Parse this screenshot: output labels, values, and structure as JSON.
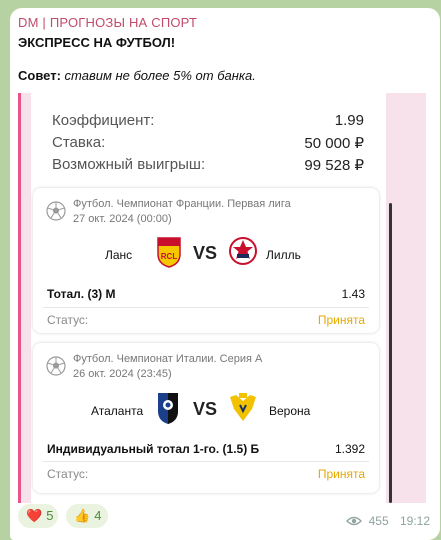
{
  "post": {
    "channel": "DM | ПРОГНОЗЫ НА СПОРТ",
    "headline": "ЭКСПРЕСС НА ФУТБОЛ!",
    "advice_label": "Совет:",
    "advice_text": "ставим не более 5% от банка."
  },
  "ticket": {
    "coef_label": "Коэффициент:",
    "coef_value": "1.99",
    "stake_label": "Ставка:",
    "stake_value": "50 000 ₽",
    "win_label": "Возможный выигрыш:",
    "win_value": "99 528 ₽"
  },
  "matches": [
    {
      "league": "Футбол. Чемпионат Франции. Первая лига",
      "date": "27 окт. 2024 (00:00)",
      "home": "Ланс",
      "vs": "VS",
      "away": "Лилль",
      "bet": "Тотал. (3) М",
      "odds": "1.43",
      "status_label": "Статус:",
      "status": "Принята",
      "home_crest_text": "RCL"
    },
    {
      "league": "Футбол. Чемпионат Италии. Серия А",
      "date": "26 окт. 2024 (23:45)",
      "home": "Аталанта",
      "vs": "VS",
      "away": "Верона",
      "bet": "Индивидуальный тотал 1-го. (1.5) Б",
      "odds": "1.392",
      "status_label": "Статус:",
      "status": "Принята"
    }
  ],
  "reactions": [
    {
      "emoji": "heart",
      "glyph": "❤️",
      "count": "5"
    },
    {
      "emoji": "thumbs-up",
      "glyph": "👍",
      "count": "4"
    }
  ],
  "meta": {
    "views": "455",
    "time": "19:12"
  },
  "colors": {
    "channel": "#c14b6a",
    "accent_bar": "#e8548a",
    "status_accepted": "#e6a800",
    "reaction_text": "#4a8c3a"
  }
}
